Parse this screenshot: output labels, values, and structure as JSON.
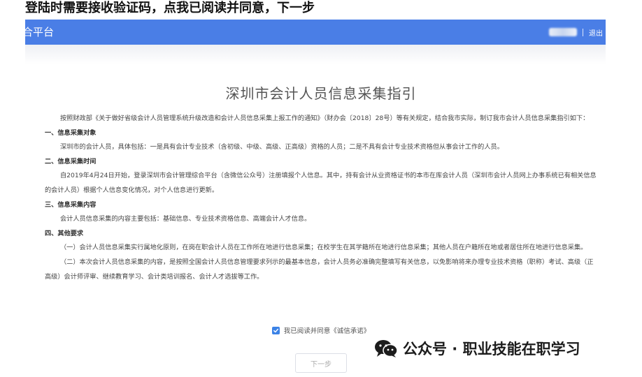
{
  "caption": "登陆时需要接收验证码，点我已阅读并同意，下一步",
  "header": {
    "brand": "合平台",
    "logout": "退出",
    "bg_color": "#4a7ee6"
  },
  "page": {
    "title": "深圳市会计人员信息采集指引",
    "intro": "按照财政部《关于做好省级会计人员管理系统升级改造和会计人员信息采集上报工作的通知》（财办会〔2018〕28号）等有关规定，结合我市实际，制订我市会计人员信息采集指引如下：",
    "sections": [
      {
        "heading": "一、信息采集对象",
        "paragraphs": [
          "深圳市的会计人员，具体包括：一是具有会计专业技术（含初级、中级、高级、正高级）资格的人员；二是不具有会计专业技术资格但从事会计工作的人员。"
        ]
      },
      {
        "heading": "二、信息采集时间",
        "paragraphs": [
          "自2019年4月24日开始，登录深圳市会计管理综合平台（含微信公众号）注册填报个人信息。其中，持有会计从业资格证书的本市在库会计人员（深圳市会计人员网上办事系统已有相关信息的会计人员）根据个人信息变化情况，对个人信息进行更新。"
        ]
      },
      {
        "heading": "三、信息采集内容",
        "paragraphs": [
          "会计人员信息采集的内容主要包括：基础信息、专业技术资格信息、高端会计人才信息。"
        ]
      },
      {
        "heading": "四、其他要求",
        "paragraphs": [
          "（一）会计人员信息采集实行属地化原则，在岗在职会计人员在工作所在地进行信息采集；在校学生在其学籍所在地进行信息采集；其他人员在户籍所在地或者居住所在地进行信息采集。",
          "（二）本次会计人员信息采集的内容，是按照全国会计人员信息管理要求列示的最基本信息，会计人员务必准确完整填写有关信息，以免影响将来办理专业技术资格（职称）考试、高级（正高级）会计师评审、继续教育学习、会计类培训报名、会计人才选拔等工作。"
        ]
      }
    ],
    "agree_label": "我已阅读并同意《诚信承诺》",
    "agree_checked": true,
    "next_button": "下一步"
  },
  "watermark": {
    "text": "公众号 · 职业技能在职学习"
  },
  "colors": {
    "checkbox": "#3b82e6",
    "title": "#555555"
  }
}
